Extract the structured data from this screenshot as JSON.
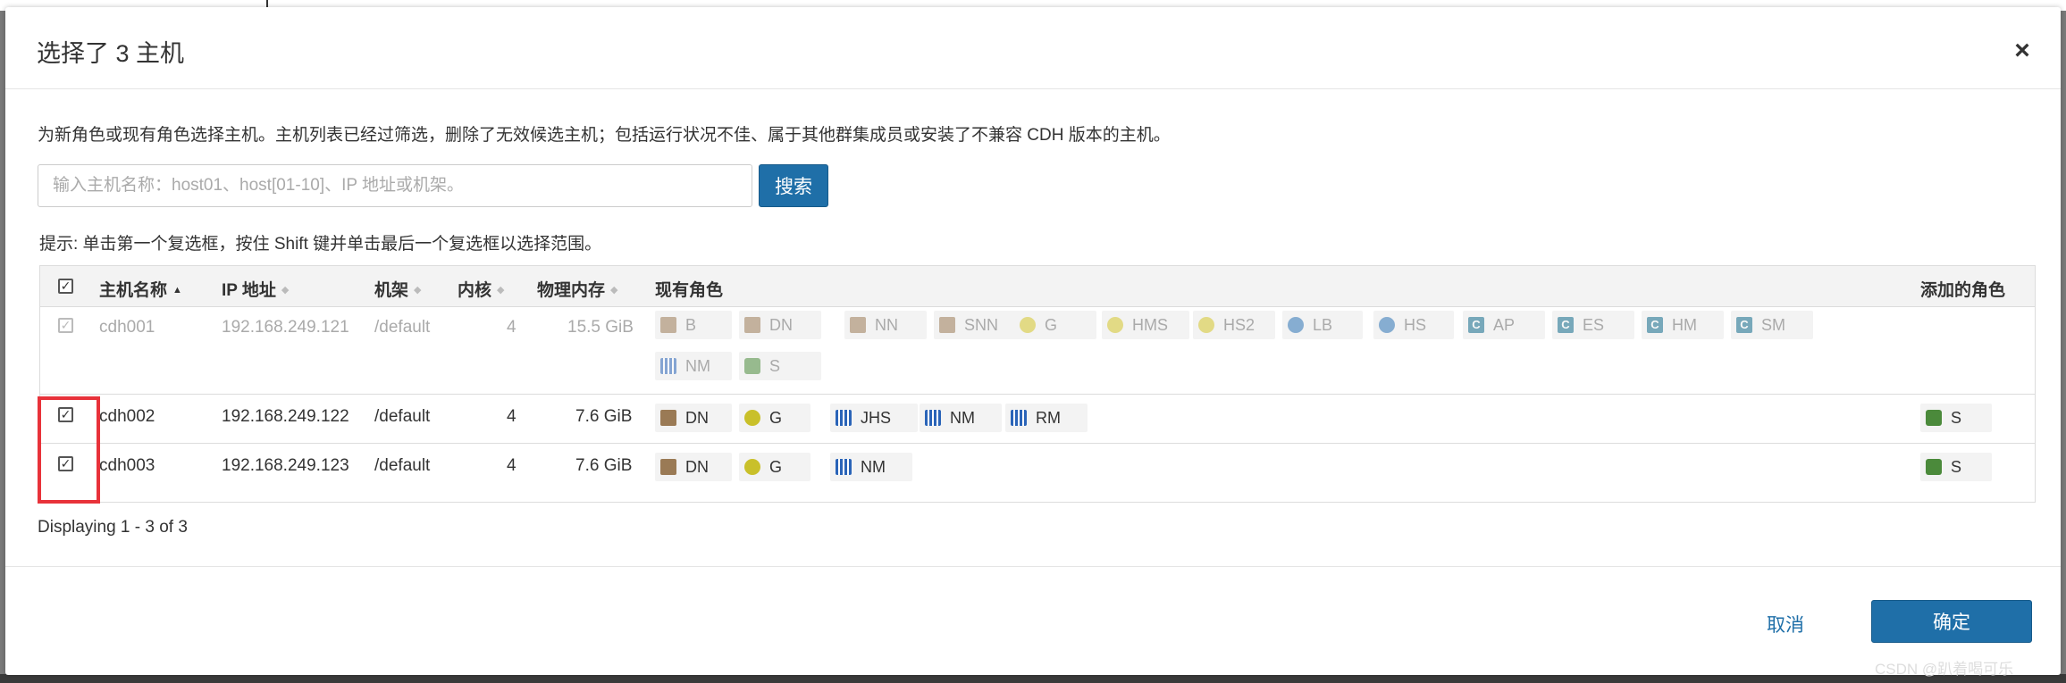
{
  "dialog": {
    "title": "选择了 3 主机",
    "description": "为新角色或现有角色选择主机。主机列表已经过筛选，删除了无效候选主机；包括运行状况不佳、属于其他群集成员或安装了不兼容 CDH 版本的主机。",
    "search_placeholder": "输入主机名称：host01、host[01-10]、IP 地址或机架。",
    "search_button": "搜索",
    "hint": "提示: 单击第一个复选框，按住 Shift 键并单击最后一个复选框以选择范围。",
    "displaying": "Displaying 1 - 3 of 3",
    "cancel_label": "取消",
    "ok_label": "确定",
    "watermark": "CSDN @趴着喝可乐"
  },
  "columns": {
    "host": "主机名称",
    "ip": "IP 地址",
    "rack": "机架",
    "cores": "内核",
    "memory": "物理内存",
    "roles": "现有角色",
    "added": "添加的角色"
  },
  "rows": [
    {
      "host": "cdh001",
      "ip": "192.168.249.121",
      "rack": "/default",
      "cores": "4",
      "memory": "15.5 GiB",
      "roles": [
        "B",
        "DN",
        "NN",
        "SNN",
        "G",
        "HMS",
        "HS2",
        "LB",
        "HS",
        "AP",
        "ES",
        "HM",
        "SM",
        "NM",
        "S"
      ],
      "added": []
    },
    {
      "host": "cdh002",
      "ip": "192.168.249.122",
      "rack": "/default",
      "cores": "4",
      "memory": "7.6 GiB",
      "roles": [
        "DN",
        "G",
        "JHS",
        "NM",
        "RM"
      ],
      "added": [
        "S"
      ]
    },
    {
      "host": "cdh003",
      "ip": "192.168.249.123",
      "rack": "/default",
      "cores": "4",
      "memory": "7.6 GiB",
      "roles": [
        "DN",
        "G",
        "NM"
      ],
      "added": [
        "S"
      ]
    }
  ]
}
